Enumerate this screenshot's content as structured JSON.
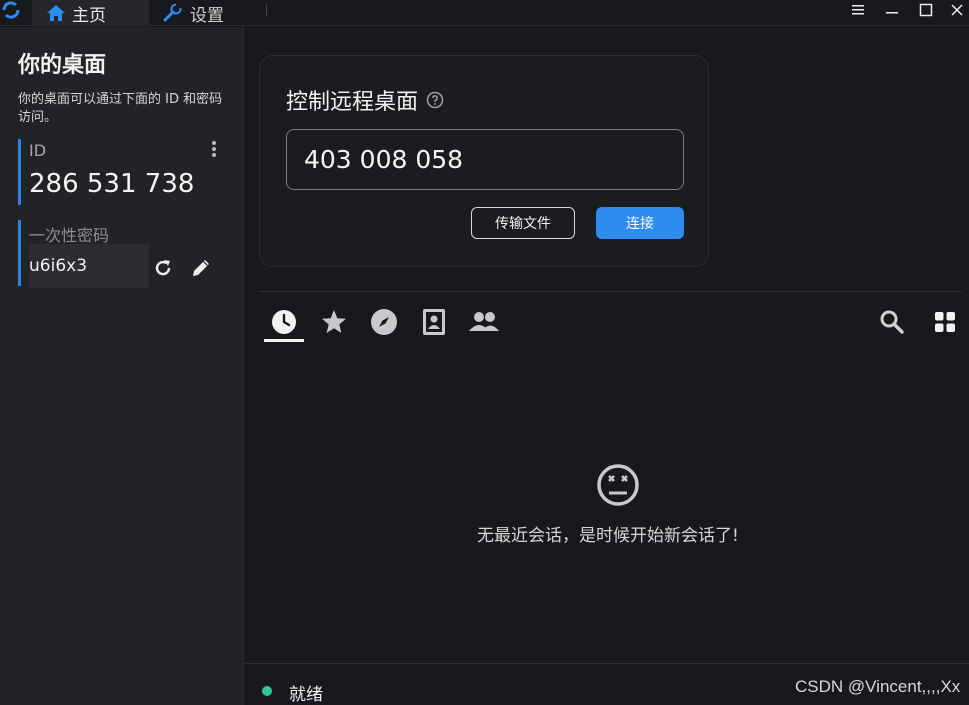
{
  "titlebar": {
    "tabs": [
      {
        "label": "主页",
        "icon": "home-icon"
      },
      {
        "label": "设置",
        "icon": "wrench-icon"
      }
    ],
    "window_controls": [
      "menu-icon",
      "minimize-icon",
      "maximize-icon",
      "close-icon"
    ]
  },
  "left": {
    "title": "你的桌面",
    "description": "你的桌面可以通过下面的 ID 和密码访问。",
    "id_label": "ID",
    "id_value": "286 531 738",
    "password_label": "一次性密码",
    "password_value": "u6i6x3"
  },
  "connect": {
    "title": "控制远程桌面",
    "remote_id": "403 008 058",
    "transfer_label": "传输文件",
    "connect_label": "连接"
  },
  "session_tabs": [
    "history-icon",
    "star-icon",
    "compass-icon",
    "address-book-icon",
    "people-icon"
  ],
  "tools": [
    "search-icon",
    "grid-view-icon"
  ],
  "empty_state": {
    "message": "无最近会话，是时候开始新会话了!"
  },
  "status": {
    "text": "就绪"
  },
  "watermark": "CSDN @Vincent,,,,Xx",
  "colors": {
    "accent": "#2d8cf0",
    "status_ok": "#33c59b",
    "background": "#18191d",
    "panel": "#222327"
  }
}
